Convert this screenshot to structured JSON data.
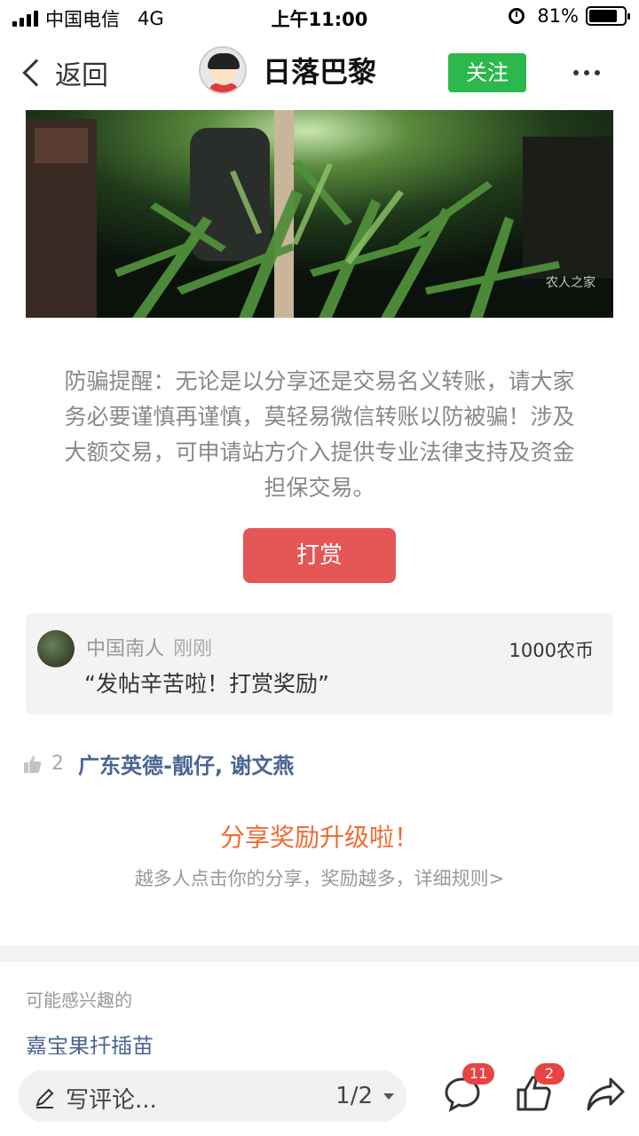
{
  "status_bar": {
    "carrier": "中国电信",
    "network": "4G",
    "time": "上午11:00",
    "battery": "81%",
    "battery_level": 0.81
  },
  "nav": {
    "back_label": "返回",
    "author_name": "日落巴黎",
    "follow_label": "关注"
  },
  "post": {
    "watermark": "农人之家",
    "warning_text": "防骗提醒：无论是以分享还是交易名义转账，请大家务必要谨慎再谨慎，莫轻易微信转账以防被骗！涉及大额交易，可申请站方介入提供专业法律支持及资金担保交易。",
    "tip_button": "打赏"
  },
  "reward": {
    "user": "中国南人",
    "time": "刚刚",
    "message": "“发帖辛苦啦！打赏奖励”",
    "amount": "1000农币"
  },
  "likes": {
    "count": "2",
    "names": "广东英德-靓仔, 谢文燕"
  },
  "share": {
    "title": "分享奖励升级啦！",
    "subtitle": "越多人点击你的分享，奖励越多，详细规则>"
  },
  "related": {
    "label": "可能感兴趣的",
    "first_item": "嘉宝果扦插苗"
  },
  "bottom_bar": {
    "comment_placeholder": "写评论...",
    "page_indicator": "1/2",
    "comment_badge": "11",
    "like_badge": "2"
  },
  "colors": {
    "follow_green": "#2db84d",
    "tip_red": "#e55757",
    "share_orange": "#ef6b34",
    "link_blue": "#4a6592",
    "badge_red": "#e84444"
  }
}
